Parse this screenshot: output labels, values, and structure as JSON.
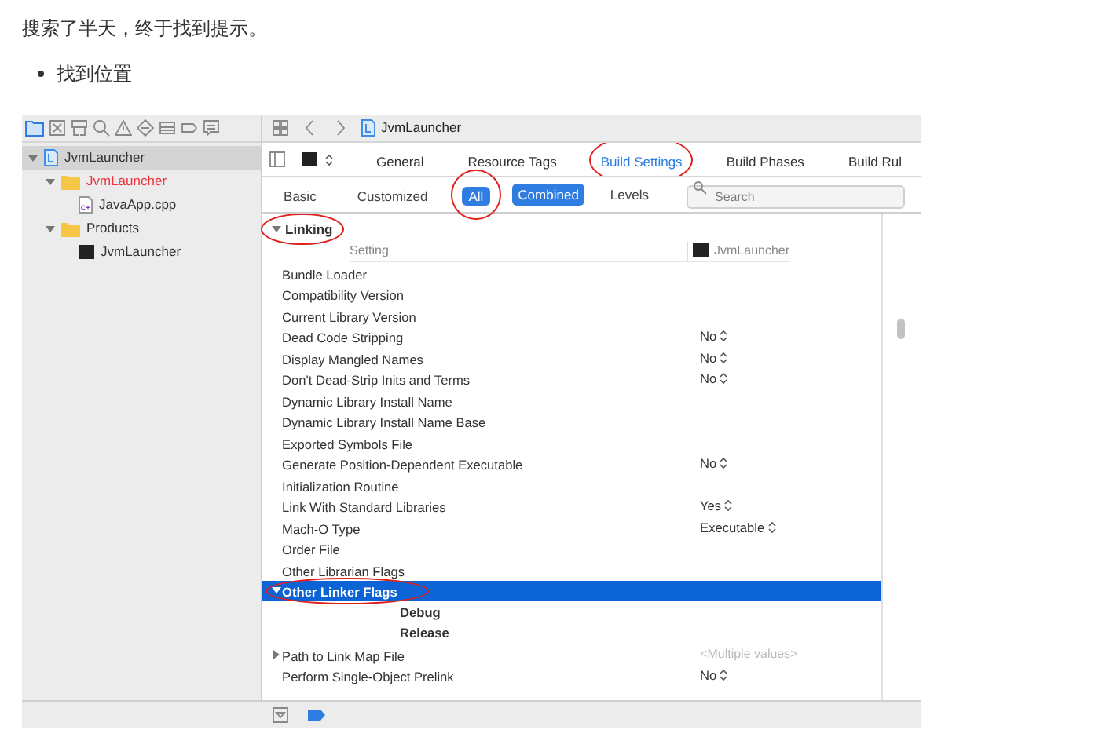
{
  "intro": "搜索了半天，终于找到提示。",
  "bullets": [
    "找到位置"
  ],
  "navigator": {
    "items": [
      {
        "label": "JvmLauncher",
        "kind": "project",
        "selected": true,
        "expanded": true,
        "missing": false,
        "children": [
          {
            "label": "JvmLauncher",
            "kind": "folder",
            "selected": false,
            "expanded": true,
            "missing": true,
            "children": [
              {
                "label": "JavaApp.cpp",
                "kind": "file",
                "selected": false,
                "missing": false
              }
            ]
          },
          {
            "label": "Products",
            "kind": "folder",
            "selected": false,
            "expanded": true,
            "missing": false,
            "children": [
              {
                "label": "JvmLauncher",
                "kind": "product",
                "selected": false,
                "missing": false
              }
            ]
          }
        ]
      }
    ]
  },
  "breadcrumb": "JvmLauncher",
  "editor_tabs": [
    {
      "label": "General",
      "selected": false,
      "circled": false
    },
    {
      "label": "Resource Tags",
      "selected": false,
      "circled": false
    },
    {
      "label": "Build Settings",
      "selected": true,
      "circled": true
    },
    {
      "label": "Build Phases",
      "selected": false,
      "circled": false
    },
    {
      "label": "Build Rul",
      "selected": false,
      "circled": false
    }
  ],
  "scope_filters": [
    {
      "label": "Basic",
      "selected": false,
      "circled": false
    },
    {
      "label": "Customized",
      "selected": false,
      "circled": false
    },
    {
      "label": "All",
      "selected": true,
      "circled": true
    }
  ],
  "view_filters": [
    {
      "label": "Combined",
      "selected": true
    },
    {
      "label": "Levels",
      "selected": false
    }
  ],
  "search": {
    "placeholder": "Search"
  },
  "section": {
    "title": "Linking",
    "expanded": true,
    "circled": true
  },
  "columns": {
    "setting": "Setting",
    "target": "JvmLauncher"
  },
  "settings": [
    {
      "name": "Bundle Loader",
      "kind": "plain"
    },
    {
      "name": "Compatibility Version",
      "kind": "plain"
    },
    {
      "name": "Current Library Version",
      "kind": "plain"
    },
    {
      "name": "Dead Code Stripping",
      "kind": "popup",
      "value": "No"
    },
    {
      "name": "Display Mangled Names",
      "kind": "popup",
      "value": "No"
    },
    {
      "name": "Don't Dead-Strip Inits and Terms",
      "kind": "popup",
      "value": "No"
    },
    {
      "name": "Dynamic Library Install Name",
      "kind": "plain"
    },
    {
      "name": "Dynamic Library Install Name Base",
      "kind": "plain"
    },
    {
      "name": "Exported Symbols File",
      "kind": "plain"
    },
    {
      "name": "Generate Position-Dependent Executable",
      "kind": "popup",
      "value": "No"
    },
    {
      "name": "Initialization Routine",
      "kind": "plain"
    },
    {
      "name": "Link With Standard Libraries",
      "kind": "popup",
      "value": "Yes"
    },
    {
      "name": "Mach-O Type",
      "kind": "popup",
      "value": "Executable"
    },
    {
      "name": "Order File",
      "kind": "plain"
    },
    {
      "name": "Other Librarian Flags",
      "kind": "plain"
    },
    {
      "name": "Other Linker Flags",
      "kind": "group",
      "selected": true,
      "expanded": true,
      "circled": true,
      "children": [
        {
          "name": "Debug"
        },
        {
          "name": "Release"
        }
      ]
    },
    {
      "name": "Path to Link Map File",
      "kind": "group",
      "selected": false,
      "expanded": false,
      "circled": false,
      "value": "<Multiple values>"
    },
    {
      "name": "Perform Single-Object Prelink",
      "kind": "popup",
      "value": "No"
    }
  ]
}
